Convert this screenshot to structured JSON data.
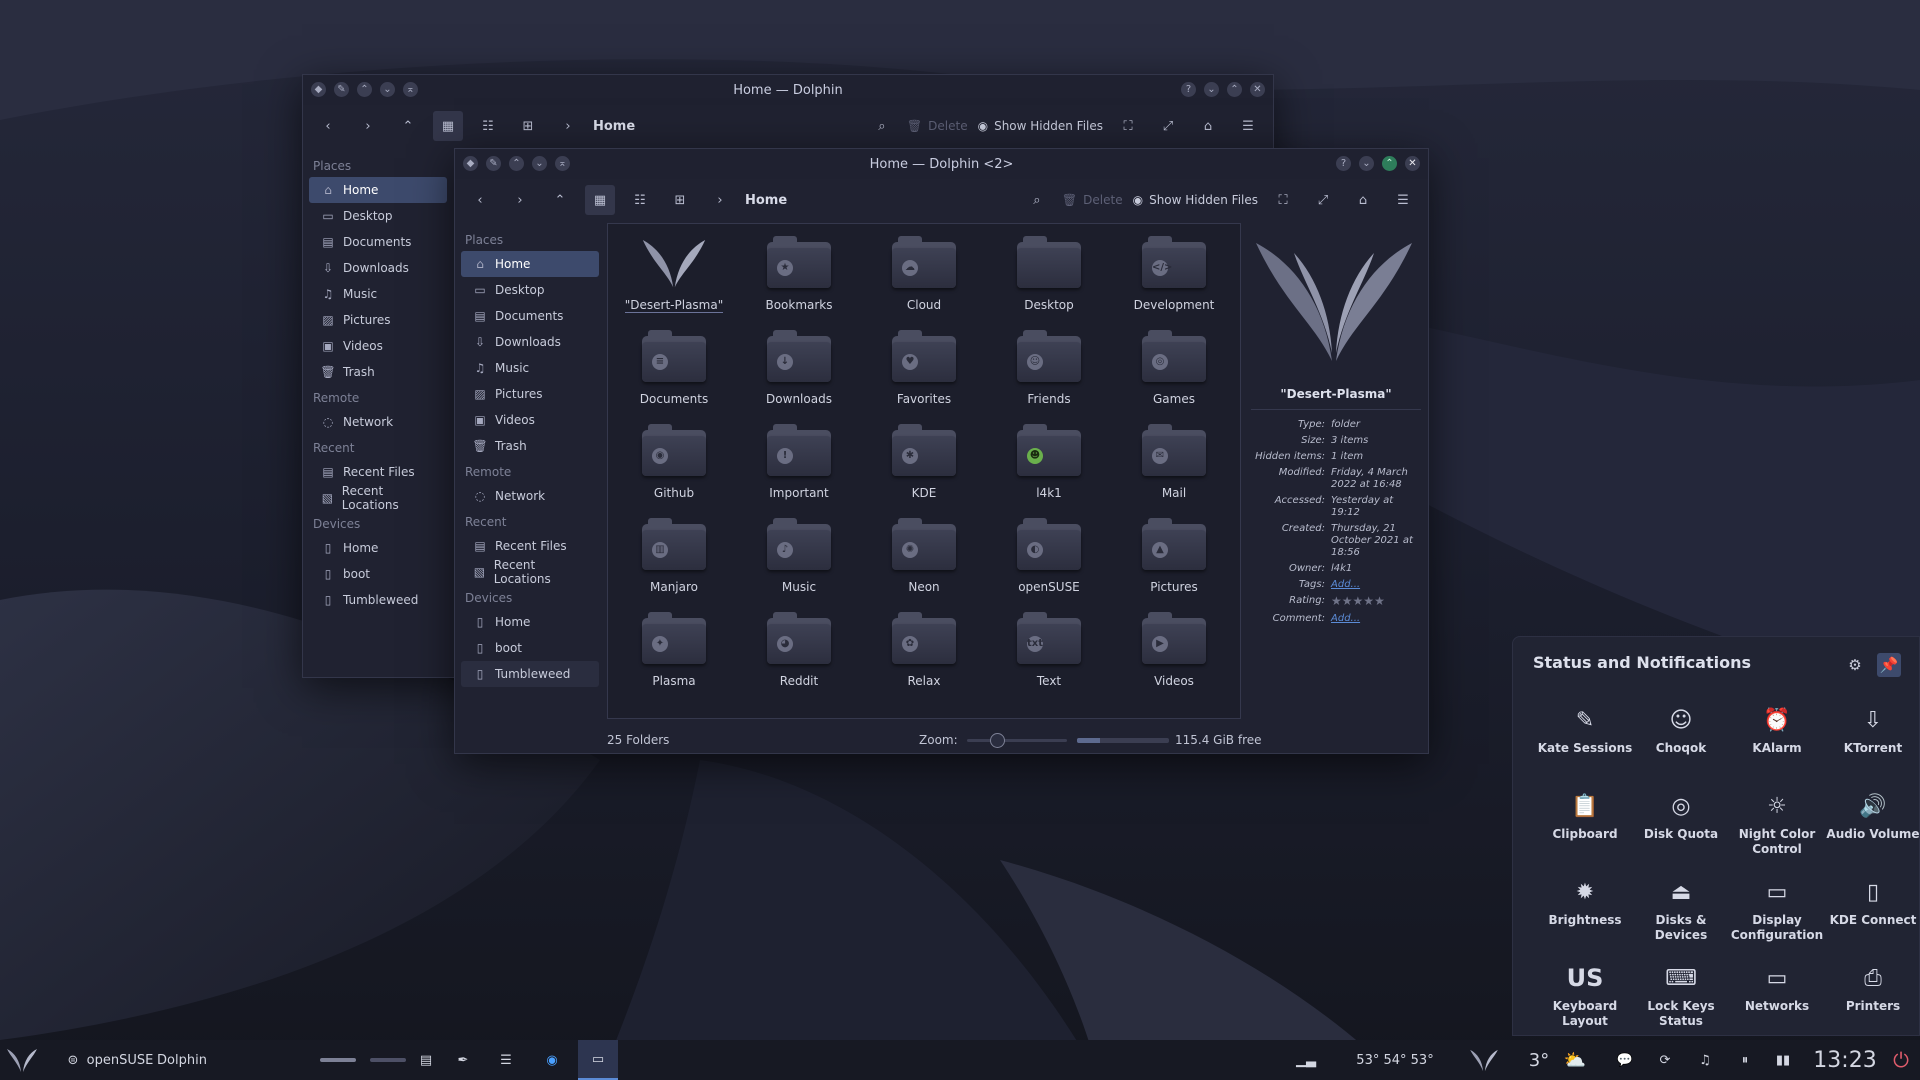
{
  "colors": {
    "accent": "#3d4a6c",
    "link": "#5b8bd6",
    "desktop": "#1a1d2b",
    "window": "#202231"
  },
  "back_window": {
    "title": "Home — Dolphin",
    "breadcrumb": "Home",
    "delete_label": "Delete",
    "hidden_label": "Show Hidden Files",
    "places_header": "Places",
    "places": [
      {
        "label": "Home",
        "icon": "home-icon"
      },
      {
        "label": "Desktop",
        "icon": "desktop-icon"
      },
      {
        "label": "Documents",
        "icon": "documents-icon"
      },
      {
        "label": "Downloads",
        "icon": "downloads-icon"
      },
      {
        "label": "Music",
        "icon": "music-icon"
      },
      {
        "label": "Pictures",
        "icon": "pictures-icon"
      },
      {
        "label": "Videos",
        "icon": "videos-icon"
      },
      {
        "label": "Trash",
        "icon": "trash-icon"
      }
    ],
    "remote_header": "Remote",
    "remote": [
      {
        "label": "Network",
        "icon": "network-icon"
      }
    ],
    "recent_header": "Recent",
    "recent": [
      {
        "label": "Recent Files",
        "icon": "recent-files-icon"
      },
      {
        "label": "Recent Locations",
        "icon": "recent-locations-icon"
      }
    ],
    "devices_header": "Devices",
    "devices": [
      {
        "label": "Home",
        "icon": "drive-icon"
      },
      {
        "label": "boot",
        "icon": "drive-icon"
      },
      {
        "label": "Tumbleweed",
        "icon": "drive-icon"
      }
    ]
  },
  "front_window": {
    "title": "Home — Dolphin <2>",
    "breadcrumb": "Home",
    "delete_label": "Delete",
    "hidden_label": "Show Hidden Files",
    "places_header": "Places",
    "remote_header": "Remote",
    "recent_header": "Recent",
    "devices_header": "Devices",
    "folders": [
      {
        "label": "\"Desert-Plasma\"",
        "emblem": ""
      },
      {
        "label": "Bookmarks",
        "emblem": "★"
      },
      {
        "label": "Cloud",
        "emblem": "☁"
      },
      {
        "label": "Desktop",
        "emblem": ""
      },
      {
        "label": "Development",
        "emblem": "</>"
      },
      {
        "label": "Documents",
        "emblem": "≡"
      },
      {
        "label": "Downloads",
        "emblem": "↓"
      },
      {
        "label": "Favorites",
        "emblem": "♥"
      },
      {
        "label": "Friends",
        "emblem": "☺"
      },
      {
        "label": "Games",
        "emblem": "◎"
      },
      {
        "label": "Github",
        "emblem": "◉"
      },
      {
        "label": "Important",
        "emblem": "!"
      },
      {
        "label": "KDE",
        "emblem": "✱"
      },
      {
        "label": "l4k1",
        "emblem": "☻"
      },
      {
        "label": "Mail",
        "emblem": "✉"
      },
      {
        "label": "Manjaro",
        "emblem": "▥"
      },
      {
        "label": "Music",
        "emblem": "♪"
      },
      {
        "label": "Neon",
        "emblem": "✺"
      },
      {
        "label": "openSUSE",
        "emblem": "◐"
      },
      {
        "label": "Pictures",
        "emblem": "▲"
      },
      {
        "label": "Plasma",
        "emblem": "✦"
      },
      {
        "label": "Reddit",
        "emblem": "◕"
      },
      {
        "label": "Relax",
        "emblem": "✿"
      },
      {
        "label": "Text",
        "emblem": "txt"
      },
      {
        "label": "Videos",
        "emblem": "▶"
      }
    ],
    "info": {
      "name": "\"Desert-Plasma\"",
      "rows": [
        {
          "k": "Type:",
          "v": "folder"
        },
        {
          "k": "Size:",
          "v": "3 items"
        },
        {
          "k": "Hidden items:",
          "v": "1 item"
        },
        {
          "k": "Modified:",
          "v": "Friday, 4 March 2022 at 16:48"
        },
        {
          "k": "Accessed:",
          "v": "Yesterday at 19:12"
        },
        {
          "k": "Created:",
          "v": "Thursday, 21 October 2021 at 18:56"
        },
        {
          "k": "Owner:",
          "v": "l4k1"
        }
      ],
      "tags_k": "Tags:",
      "tags_v": "Add...",
      "rating_k": "Rating:",
      "rating": 0,
      "rating_max": 5,
      "comment_k": "Comment:",
      "comment_v": "Add..."
    },
    "status_count": "25 Folders",
    "zoom_label": "Zoom:",
    "free_space": "115.4 GiB free",
    "zoom_level": 0.3,
    "space_used": 0.25
  },
  "notifications": {
    "title": "Status and Notifications",
    "tiles": [
      {
        "label": "Kate Sessions",
        "icon": "kate-icon"
      },
      {
        "label": "Choqok",
        "icon": "choqok-icon"
      },
      {
        "label": "KAlarm",
        "icon": "alarm-icon"
      },
      {
        "label": "KTorrent",
        "icon": "torrent-icon"
      },
      {
        "label": "Clipboard",
        "icon": "clipboard-icon"
      },
      {
        "label": "Disk Quota",
        "icon": "disk-quota-icon"
      },
      {
        "label": "Night Color Control",
        "icon": "night-color-icon"
      },
      {
        "label": "Audio Volume",
        "icon": "audio-volume-icon"
      },
      {
        "label": "Brightness",
        "icon": "brightness-icon"
      },
      {
        "label": "Disks & Devices",
        "icon": "disks-icon"
      },
      {
        "label": "Display Configuration",
        "icon": "display-icon"
      },
      {
        "label": "KDE Connect",
        "icon": "kde-connect-icon"
      },
      {
        "label": "Keyboard Layout",
        "icon": "keyboard-layout-icon",
        "text": "US"
      },
      {
        "label": "Lock Keys Status",
        "icon": "lock-keys-icon"
      },
      {
        "label": "Networks",
        "icon": "networks-icon"
      },
      {
        "label": "Printers",
        "icon": "printer-icon"
      }
    ]
  },
  "taskbar": {
    "task1": "openSUSE",
    "task2": "Dolphin",
    "temps": "53° 54° 53°",
    "weather": "3°",
    "clock": "13:23"
  }
}
